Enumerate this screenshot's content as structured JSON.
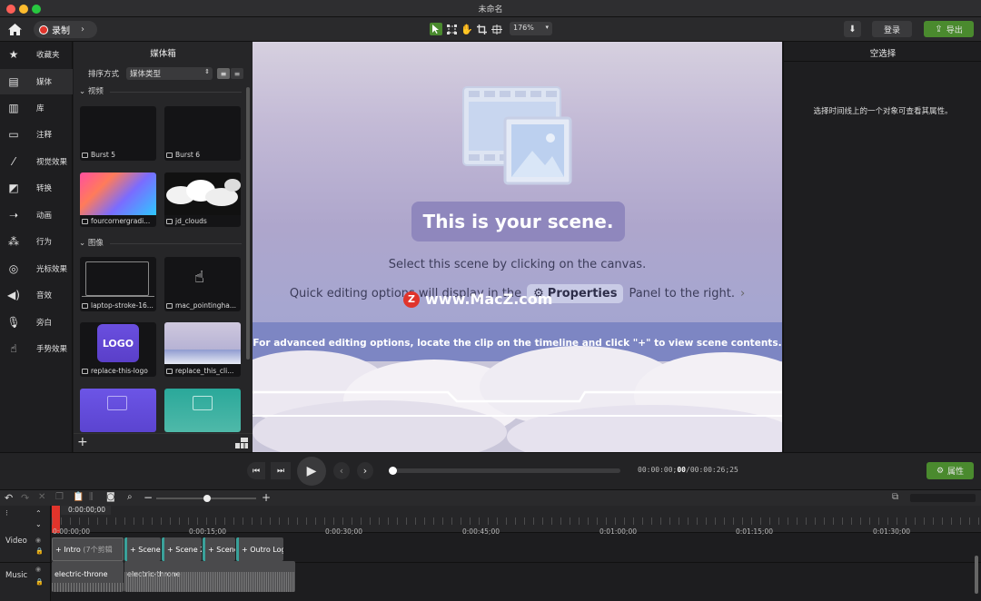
{
  "window": {
    "title": "未命名"
  },
  "toolbar": {
    "record_label": "录制",
    "zoom": "176%",
    "login_label": "登录",
    "export_label": "导出"
  },
  "sidebar": {
    "items": [
      {
        "label": "收藏夹",
        "icon": "star-icon"
      },
      {
        "label": "媒体",
        "icon": "film-icon"
      },
      {
        "label": "库",
        "icon": "library-icon"
      },
      {
        "label": "注释",
        "icon": "annotation-icon"
      },
      {
        "label": "视觉效果",
        "icon": "magic-wand-icon"
      },
      {
        "label": "转换",
        "icon": "transition-icon"
      },
      {
        "label": "动画",
        "icon": "animation-icon"
      },
      {
        "label": "行为",
        "icon": "behavior-icon"
      },
      {
        "label": "光标效果",
        "icon": "cursor-effect-icon"
      },
      {
        "label": "音效",
        "icon": "speaker-icon"
      },
      {
        "label": "旁白",
        "icon": "microphone-icon"
      },
      {
        "label": "手势效果",
        "icon": "hand-gesture-icon"
      }
    ]
  },
  "media_bin": {
    "title": "媒体箱",
    "sort_label": "排序方式",
    "sort_value": "媒体类型",
    "section_video": "视频",
    "section_image": "图像",
    "items": [
      {
        "name": "Burst 5"
      },
      {
        "name": "Burst 6"
      },
      {
        "name": "fourcornergradi..."
      },
      {
        "name": "jd_clouds"
      },
      {
        "name": "laptop-stroke-16..."
      },
      {
        "name": "mac_pointingha..."
      },
      {
        "name": "replace-this-logo"
      },
      {
        "name": "replace_this_cli..."
      }
    ],
    "logo_text": "LOGO"
  },
  "canvas": {
    "headline": "This is your scene.",
    "line1": "Select this scene by clicking on the canvas.",
    "line2_pre": "Quick editing options will display in the",
    "properties_chip": "Properties",
    "line2_post": "Panel to the right.",
    "line3": "For advanced editing options, locate the clip on the timeline and click \"+\" to view scene contents.",
    "watermark": "www.MacZ.com",
    "watermark_badge": "Z"
  },
  "right_panel": {
    "title": "空选择",
    "hint": "选择时间线上的一个对象可查看其属性。"
  },
  "playback": {
    "time_current": "00:00:00;",
    "time_frames": "00",
    "time_total": "/00:00:26;25",
    "properties_button": "属性",
    "progress": 0.0
  },
  "timeline": {
    "playhead_time": "0:00:00;00",
    "ticks": [
      "0:00:00;00",
      "0:00:15;00",
      "0:00:30;00",
      "0:00:45;00",
      "0:01:00;00",
      "0:01:15;00",
      "0:01:30;00"
    ],
    "tracks": [
      {
        "name": "Video",
        "clips": [
          {
            "label": "+ Intro",
            "extra": "(7个剪辑"
          },
          {
            "label": "+ Scene"
          },
          {
            "label": "+ Scene 2"
          },
          {
            "label": "+ Scene"
          },
          {
            "label": "+ Outro Log"
          }
        ]
      },
      {
        "name": "Music",
        "clips": [
          {
            "label": "electric-throne"
          },
          {
            "label": "electric-throne"
          }
        ]
      }
    ]
  },
  "colors": {
    "accent_green": "#4a8a2e",
    "record_red": "#e0342b",
    "clip_teal": "#3aa19a"
  }
}
